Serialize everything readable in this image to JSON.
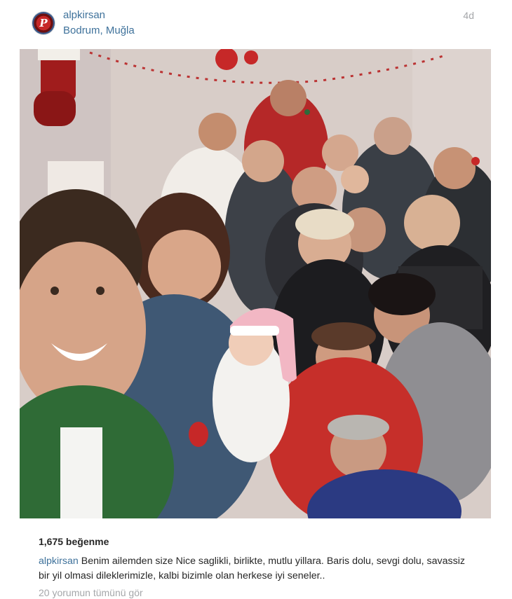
{
  "post": {
    "username": "alpkirsan",
    "location": "Bodrum, Muğla",
    "time_ago": "4d",
    "avatar_letter": "P",
    "likes": "1,675 beğenme",
    "caption_user": "alpkirsan",
    "caption_text": "Benim ailemden size Nice saglikli, birlikte, mutlu yillara. Baris dolu, sevgi dolu, savassiz bir yil olmasi dileklerimizle, kalbi bizimle olan herkese iyi seneler..",
    "view_comments": "20 yorumun tümünü gör"
  },
  "colors": {
    "link": "#3f729b",
    "text": "#262626",
    "muted": "#a5a7aa"
  }
}
